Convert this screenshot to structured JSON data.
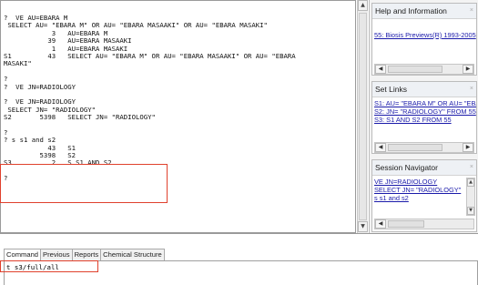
{
  "output_lines": [
    "?  VE AU=EBARA M",
    " SELECT AU= \"EBARA M\" OR AU= \"EBARA MASAAKI\" OR AU= \"EBARA MASAKI\"",
    "            3   AU=EBARA M",
    "           39   AU=EBARA MASAAKI",
    "            1   AU=EBARA MASAKI",
    "S1         43   SELECT AU= \"EBARA M\" OR AU= \"EBARA MASAAKI\" OR AU= \"EBARA",
    "MASAKI\"",
    "",
    "?",
    "?  VE JN=RADIOLOGY",
    "",
    "?  VE JN=RADIOLOGY",
    " SELECT JN= \"RADIOLOGY\"",
    "S2       5398   SELECT JN= \"RADIOLOGY\"",
    "",
    "?",
    "? s s1 and s2",
    "           43   S1",
    "         5398   S2",
    "S3          2   S S1 AND S2",
    "",
    "?"
  ],
  "panels": {
    "help": {
      "title": "Help and Information",
      "links": [
        "55: Biosis Previews(R) 1993-2005"
      ]
    },
    "set_links": {
      "title": "Set Links",
      "links": [
        "S1: AU= \"EBARA M\" OR AU= \"EBA",
        "S2: JN= \"RADIOLOGY\" FROM 55",
        "S3: S1 AND S2 FROM 55"
      ]
    },
    "session_navigator": {
      "title": "Session Navigator",
      "links": [
        "VE JN=RADIOLOGY",
        "SELECT JN= \"RADIOLOGY\"",
        "s s1 and s2"
      ]
    },
    "close_symbol": "×"
  },
  "tabs": [
    "Command",
    "Previous",
    "Reports",
    "Chemical Structure"
  ],
  "command": {
    "value": "t s3/full/all"
  },
  "scroll_glyphs": {
    "up": "▲",
    "down": "▼",
    "left": "◀",
    "right": "▶",
    "grip": "≡",
    "dots": "⁝"
  }
}
